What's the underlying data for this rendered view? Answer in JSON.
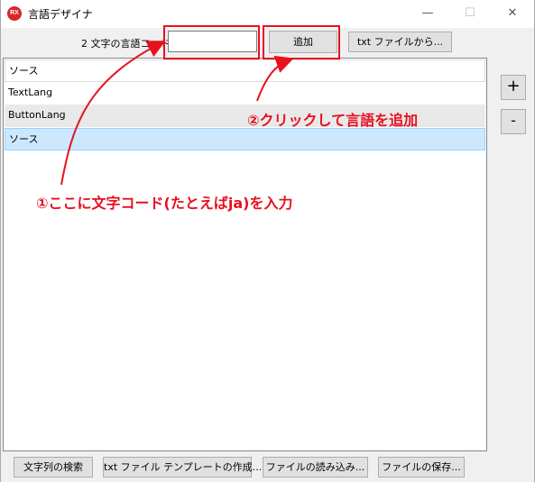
{
  "window": {
    "app_icon_text": "RX",
    "title": "言語デザイナ",
    "minimize": "—",
    "maximize": "☐",
    "close": "✕"
  },
  "toolbar": {
    "code_label": "2 文字の言語コード",
    "code_value": "",
    "add_label": "追加",
    "txt_file_label": "txt ファイルから..."
  },
  "languages": [
    "ソース",
    "TextLang",
    "ButtonLang",
    "ソース"
  ],
  "side_buttons": {
    "plus": "+",
    "minus": "-"
  },
  "bottom_buttons": {
    "search": "文字列の検索",
    "template": "txt ファイル テンプレートの作成...",
    "load": "ファイルの読み込み...",
    "save": "ファイルの保存..."
  },
  "annotations": {
    "step1": "①ここに文字コード(たとえばja)を入力",
    "step2": "②クリックして言語を追加",
    "color": "#e8101f"
  }
}
